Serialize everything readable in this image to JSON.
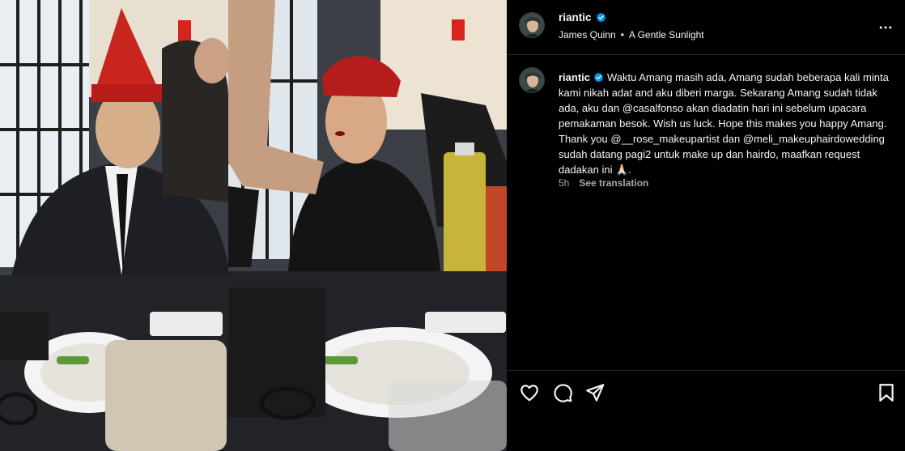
{
  "post": {
    "username": "riantic",
    "verified": true,
    "audio_artist": "James Quinn",
    "audio_separator": "•",
    "audio_title": "A Gentle Sunlight"
  },
  "caption": {
    "username": "riantic",
    "text": "Waktu Amang masih ada, Amang sudah beberapa kali minta kami nikah adat and aku diberi marga. Sekarang Amang sudah tidak ada, aku dan @casalfonso akan diadatin hari ini sebelum upacara pemakaman besok. Wish us luck. Hope this makes you happy Amang. Thank you @__rose_makeupartist dan @meli_makeuphairdowedding sudah datang pagi2 untuk make up dan hairdo, maafkan request dadakan ini 🙏🏻.",
    "time": "5h",
    "see_translation": "See translation"
  },
  "icons": {
    "verified": "verified-badge-icon",
    "more": "more-options-icon",
    "like": "heart-icon",
    "comment": "comment-icon",
    "share": "send-icon",
    "save": "bookmark-icon"
  },
  "colors": {
    "background": "#000000",
    "verified": "#0095f6",
    "divider": "#262626",
    "secondary_text": "#a8a8a8"
  }
}
